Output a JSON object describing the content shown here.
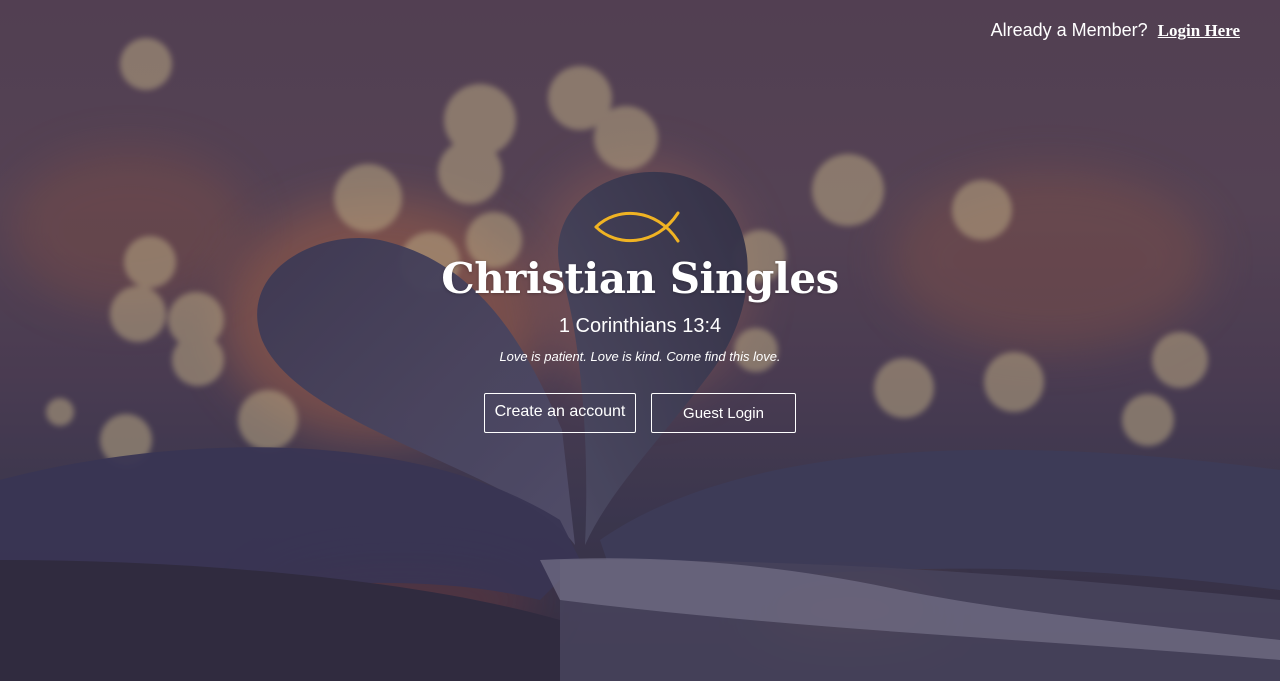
{
  "header": {
    "member_prompt": "Already a Member?",
    "login_link": "Login Here"
  },
  "hero": {
    "logo_icon": "ichthys-fish-icon",
    "title": "Christian Singles",
    "verse": "1 Corinthians 13:4",
    "tagline": "Love is patient. Love is kind. Come find this love."
  },
  "actions": {
    "create_account": "Create an account",
    "guest_login": "Guest Login"
  },
  "colors": {
    "accent": "#f0b323",
    "text": "#ffffff"
  }
}
